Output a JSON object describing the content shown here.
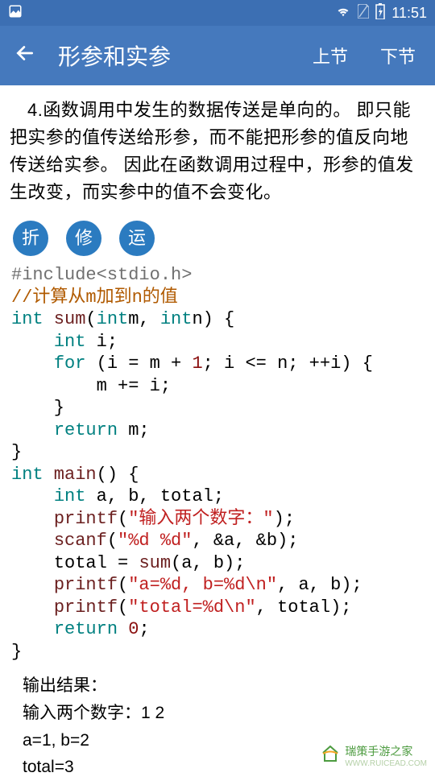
{
  "status": {
    "time": "11:51"
  },
  "appbar": {
    "title": "形参和实参",
    "prev": "上节",
    "next": "下节"
  },
  "paragraph": "4.函数调用中发生的数据传送是单向的。 即只能把实参的值传送给形参，而不能把形参的值反向地传送给实参。 因此在函数调用过程中，形参的值发生改变，而实参中的值不会变化。",
  "buttons": {
    "b1": "折",
    "b2": "修",
    "b3": "运"
  },
  "code": {
    "c01_a": "#include",
    "c01_b": "<stdio.h>",
    "c02": "//计算从m加到n的值",
    "c03_kw1": "int",
    "c03_fn": " sum",
    "c03_rest_a": "(",
    "c03_kw2": "int",
    "c03_rest_b": "m, ",
    "c03_kw3": "int",
    "c03_rest_c": "n) {",
    "c04_kw": "int",
    "c04_rest": " i;",
    "c05_kw": "for",
    "c05_a": " (i = m + ",
    "c05_n1": "1",
    "c05_b": "; i <= n; ++i) {",
    "c06": "        m += i;",
    "c07": "    }",
    "c08_kw": "return",
    "c08_rest": " m;",
    "c09": "}",
    "c10_kw": "int",
    "c10_fn": " main",
    "c10_rest": "() {",
    "c11_kw": "int",
    "c11_rest": " a, b, total;",
    "c12_fn": "printf",
    "c12_a": "(",
    "c12_str": "\"输入两个数字：\"",
    "c12_b": ");",
    "c13_fn": "scanf",
    "c13_a": "(",
    "c13_str": "\"%d %d\"",
    "c13_b": ", &a, &b);",
    "c14_a": "    total = ",
    "c14_fn": "sum",
    "c14_b": "(a, b);",
    "c15_fn": "printf",
    "c15_a": "(",
    "c15_str": "\"a=%d, b=%d\\n\"",
    "c15_b": ", a, b);",
    "c16_fn": "printf",
    "c16_a": "(",
    "c16_str": "\"total=%d\\n\"",
    "c16_b": ", total);",
    "c17_kw": "return",
    "c17_a": " ",
    "c17_n": "0",
    "c17_b": ";",
    "c18": "}"
  },
  "output": {
    "title": "输出结果：",
    "line1": "输入两个数字：1 2",
    "line2": "a=1, b=2",
    "line3": "total=3"
  },
  "watermark": {
    "text1": "瑞策手游之家",
    "text2": "WWW.RUICEAD.COM"
  }
}
